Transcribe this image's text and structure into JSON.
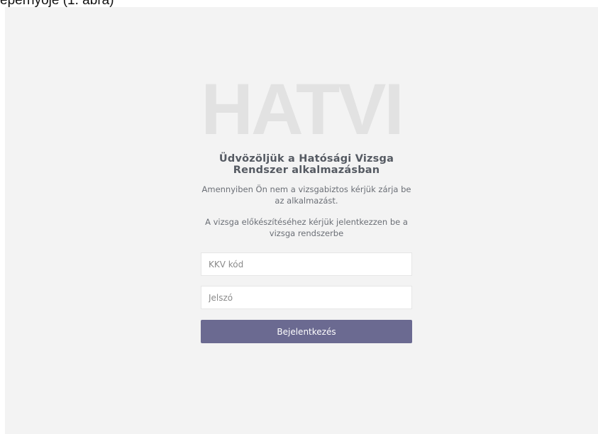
{
  "caption": "épernyője (1. ábra)",
  "logo": {
    "text": "HATVI",
    "color": "#e2e2e2"
  },
  "login": {
    "title": "Üdvözöljük a Hatósági Vizsga Rendszer alkalmazásban",
    "notice": "Amennyiben Ön nem a vizsgabiztos kérjük zárja be az alkalmazást.",
    "instruction": "A vizsga előkészítéséhez kérjük jelentkezzen be a vizsga rendszerbe",
    "kkv_placeholder": "KKV kód",
    "password_placeholder": "Jelszó",
    "submit_label": "Bejelentkezés",
    "accent_color": "#6b6a91",
    "background_color": "#f3f3f3"
  }
}
